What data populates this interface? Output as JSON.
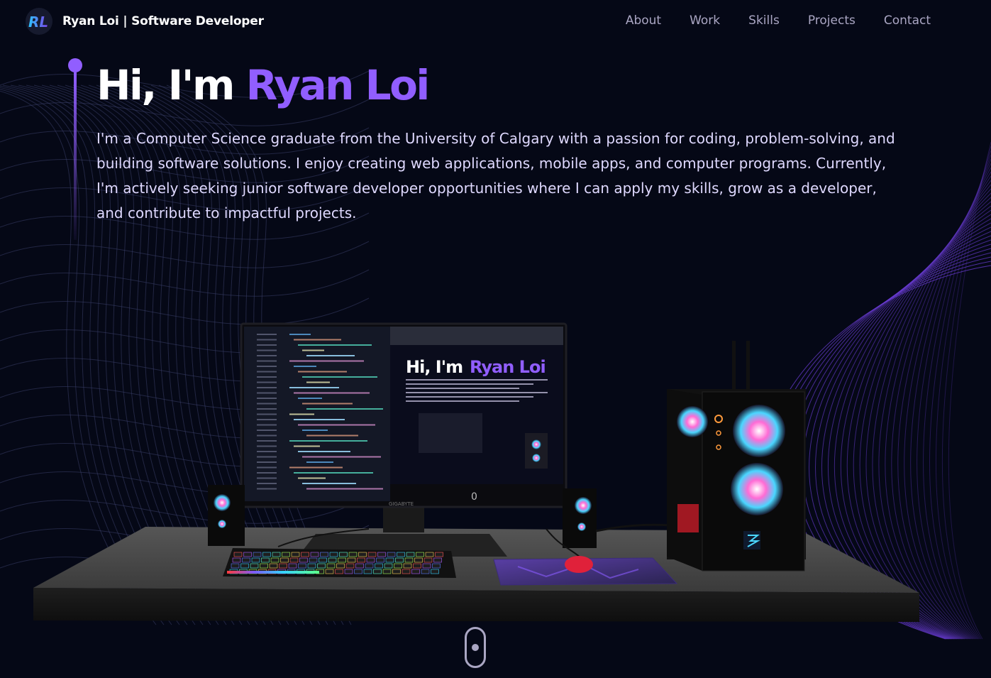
{
  "nav": {
    "logo_text": "RL",
    "brand": "Ryan Loi | Software Developer",
    "links": [
      "About",
      "Work",
      "Skills",
      "Projects",
      "Contact"
    ]
  },
  "hero": {
    "greeting": "Hi, I'm ",
    "name": "Ryan Loi",
    "description": "I'm a Computer Science graduate from the University of Calgary with a passion for coding, problem-solving, and building software solutions. I enjoy creating web applications, mobile apps, and computer programs. Currently, I'm actively seeking junior software developer opportunities where I can apply my skills, grow as a developer, and contribute to impactful projects."
  },
  "scene": {
    "monitor_brand": "GIGABYTE",
    "screen_title_part1": "Hi, I'm",
    "screen_title_part2": "Ryan Loi"
  },
  "colors": {
    "background": "#050816",
    "accent": "#915eff",
    "text_secondary": "#aaa6c3"
  }
}
